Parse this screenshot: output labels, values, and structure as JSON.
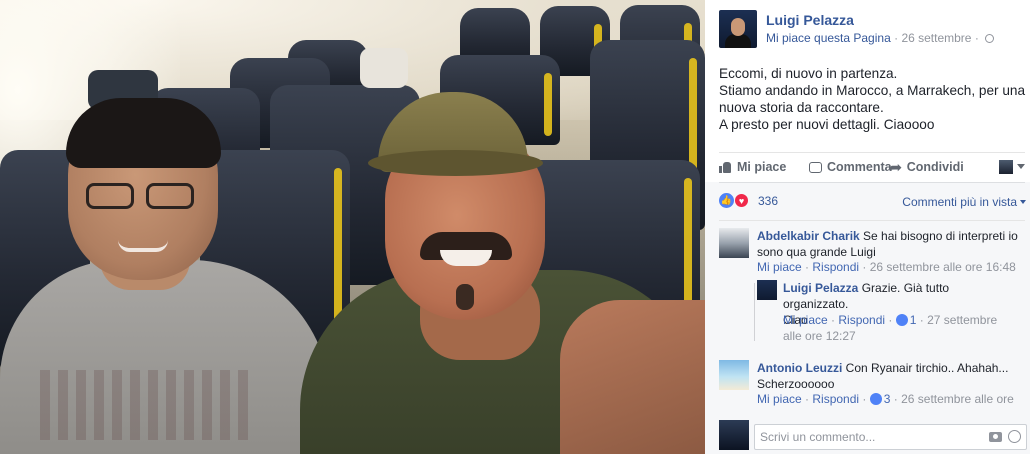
{
  "post": {
    "page_name": "Luigi Pelazza",
    "like_page": "Mi piace questa Pagina",
    "date": "26 settembre",
    "text_lines": [
      "Eccomi, di nuovo in partenza.",
      "Stiamo andando in Marocco, a Marrakech, per una",
      "nuova storia da raccontare.",
      "A presto per nuovi dettagli. Ciaoooo"
    ]
  },
  "actions": {
    "like": "Mi piace",
    "comment": "Commenta",
    "share": "Condividi"
  },
  "reactions": {
    "count": "336",
    "sort_label": "Commenti più in vista"
  },
  "comments": [
    {
      "author": "Abdelkabir Charik",
      "text_line1": "Se hai bisogno di interpreti io",
      "text_line2": "sono qua grande Luigi",
      "like": "Mi piace",
      "reply": "Rispondi",
      "time": "26 settembre alle ore 16:48"
    },
    {
      "author": "Luigi Pelazza",
      "text_line1": "Grazie. Già tutto organizzato.",
      "text_line2": "Ciao",
      "like": "Mi piace",
      "reply": "Rispondi",
      "likes": "1",
      "time_line1": "27 settembre",
      "time_line2": "alle ore 12:27"
    },
    {
      "author": "Antonio Leuzzi",
      "text_line1": "Con Ryanair tirchio.. Ahahah...",
      "text_line2": "Scherzoooooo",
      "like": "Mi piace",
      "reply": "Rispondi",
      "likes": "3",
      "time": "26 settembre alle ore"
    }
  ],
  "composer": {
    "placeholder": "Scrivi un commento..."
  },
  "colors": {
    "link": "#365899",
    "meta": "#90949c",
    "comments_bg": "#f6f7f9",
    "like_blue": "#4f82f7",
    "love_red": "#f0284a"
  },
  "icons": [
    "globe-icon",
    "like-thumb-icon",
    "comment-bubble-icon",
    "share-arrow-icon",
    "camera-icon",
    "emoji-icon"
  ]
}
